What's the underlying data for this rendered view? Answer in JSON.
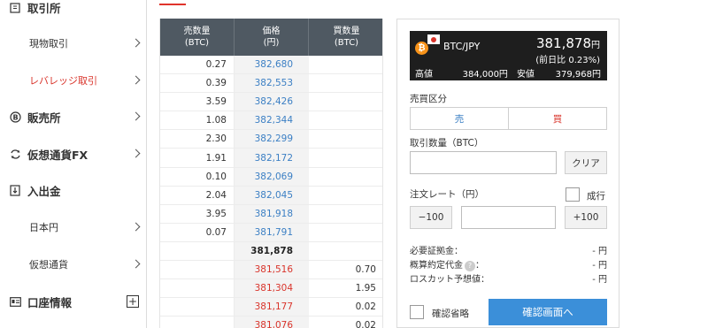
{
  "sidebar": {
    "items": [
      {
        "label": "取引所",
        "icon": "building-icon"
      },
      {
        "label": "現物取引"
      },
      {
        "label": "レバレッジ取引"
      },
      {
        "label": "販売所",
        "icon": "bitcoin-circle-icon"
      },
      {
        "label": "仮想通貨FX",
        "icon": "exchange-arrows-icon"
      },
      {
        "label": "入出金",
        "icon": "deposit-icon"
      },
      {
        "label": "日本円"
      },
      {
        "label": "仮想通貨"
      },
      {
        "label": "口座情報",
        "icon": "id-card-icon"
      }
    ],
    "expand_symbol": "+"
  },
  "book": {
    "headers": {
      "sell_qty": "売数量",
      "sell_qty_unit": "(BTC)",
      "price": "価格",
      "price_unit": "(円)",
      "buy_qty": "買数量",
      "buy_qty_unit": "(BTC)"
    },
    "asks": [
      {
        "qty": "0.27",
        "price": "382,680"
      },
      {
        "qty": "0.39",
        "price": "382,553"
      },
      {
        "qty": "3.59",
        "price": "382,426"
      },
      {
        "qty": "1.08",
        "price": "382,344"
      },
      {
        "qty": "2.30",
        "price": "382,299"
      },
      {
        "qty": "1.91",
        "price": "382,172"
      },
      {
        "qty": "0.10",
        "price": "382,069"
      },
      {
        "qty": "2.04",
        "price": "382,045"
      },
      {
        "qty": "3.95",
        "price": "381,918"
      },
      {
        "qty": "0.07",
        "price": "381,791"
      }
    ],
    "mid_price": "381,878",
    "bids": [
      {
        "price": "381,516",
        "qty": "0.70"
      },
      {
        "price": "381,304",
        "qty": "1.95"
      },
      {
        "price": "381,177",
        "qty": "0.02"
      },
      {
        "price": "381,076",
        "qty": "0.02"
      }
    ]
  },
  "panel": {
    "coin_symbol": "₿",
    "pair": "BTC/JPY",
    "price": "381,878",
    "price_unit": "円",
    "change": "(前日比 0.23%)",
    "high_label": "高値",
    "high_value": "384,000円",
    "low_label": "安値",
    "low_value": "379,968円",
    "side_label": "売買区分",
    "sell_label": "売",
    "buy_label": "買",
    "qty_label": "取引数量（BTC）",
    "clear_label": "クリア",
    "rate_label": "注文レート（円）",
    "market_label": "成行",
    "minus_label": "−100",
    "plus_label": "+100",
    "margin_label": "必要証拠金：",
    "margin_value": "- 円",
    "est_label": "概算約定代金",
    "est_colon": "：",
    "est_value": "- 円",
    "help_symbol": "?",
    "losscut_label": "ロスカット予想値：",
    "losscut_value": "- 円",
    "skip_confirm_label": "確認省略",
    "confirm_label": "確認画面へ"
  },
  "colors": {
    "ask": "#3b7fc4",
    "bid": "#d9342b",
    "header_bg": "#4f5962",
    "accent_red": "#d9342b",
    "confirm_bg": "#3b8fd9"
  }
}
